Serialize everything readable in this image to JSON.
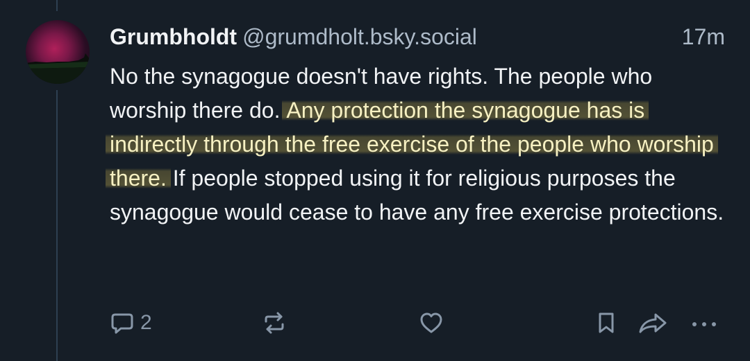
{
  "post": {
    "display_name": "Grumbholdt",
    "handle": "@grumdholt.bsky.social",
    "timestamp": "17m",
    "text_before": "No the synagogue doesn't have rights. The people who worship there do.",
    "text_highlight": "Any protection the synagogue has is indirectly through the free exercise of the people who worship there.",
    "text_after": "If people stopped using it for religious purposes the synagogue would cease to have any free exercise protections."
  },
  "actions": {
    "reply_count": "2",
    "reply_icon": "speech-bubble-icon",
    "repost_icon": "repost-arrows-icon",
    "like_icon": "heart-icon",
    "bookmark_icon": "bookmark-icon",
    "share_icon": "share-arrow-icon",
    "more_icon": "ellipsis-icon"
  },
  "colors": {
    "background": "#161e27",
    "text": "#f1f3f5",
    "muted": "#aebbc9",
    "icon": "#8897a8",
    "highlight": "#70683a"
  }
}
